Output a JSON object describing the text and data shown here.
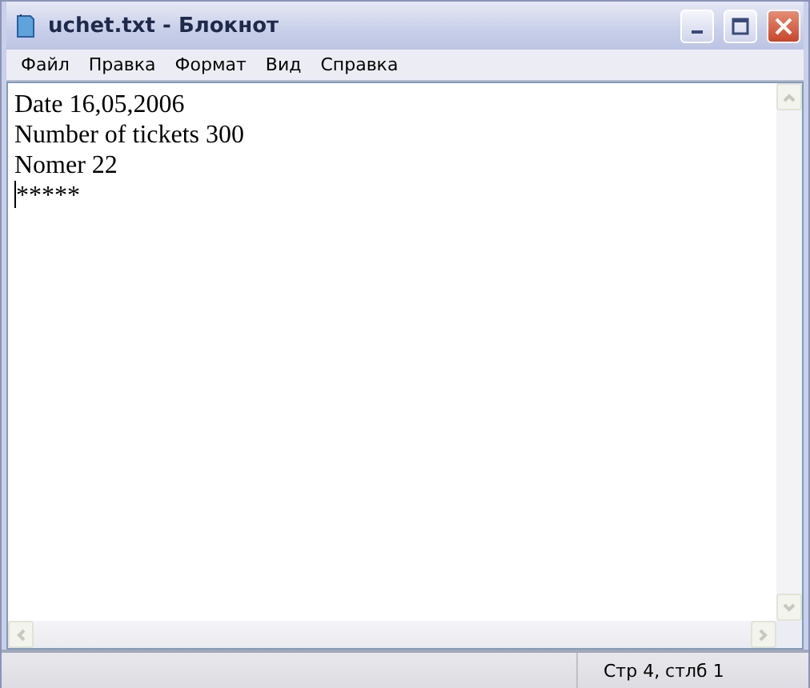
{
  "window": {
    "title": "uchet.txt - Блокнот"
  },
  "menu": [
    "Файл",
    "Правка",
    "Формат",
    "Вид",
    "Справка"
  ],
  "editor": {
    "lines": [
      "Date 16,05,2006",
      "Number of tickets 300",
      "Nomer 22",
      "*****"
    ]
  },
  "status_bar": {
    "position": "Стр 4, стлб 1"
  }
}
